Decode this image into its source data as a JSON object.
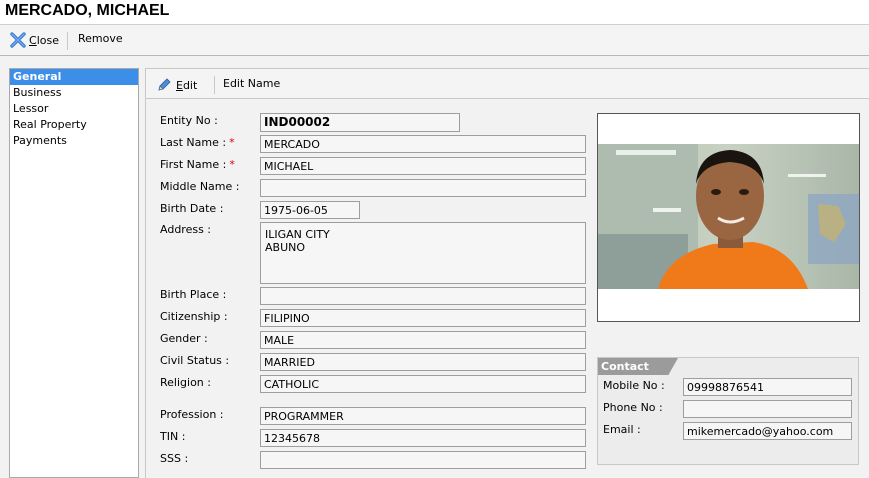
{
  "window": {
    "title": "MERCADO, MICHAEL"
  },
  "top_toolbar": {
    "close_label": "Close",
    "remove_label": "Remove"
  },
  "sidebar": {
    "items": [
      {
        "label": "General",
        "selected": true
      },
      {
        "label": "Business"
      },
      {
        "label": "Lessor"
      },
      {
        "label": "Real Property"
      },
      {
        "label": "Payments"
      }
    ]
  },
  "content_toolbar": {
    "edit_label": "Edit",
    "edit_name_label": "Edit Name"
  },
  "form": {
    "entity_no": {
      "label": "Entity No :",
      "value": "IND00002"
    },
    "last_name": {
      "label": "Last Name :",
      "required": "*",
      "value": "MERCADO"
    },
    "first_name": {
      "label": "First Name :",
      "required": "*",
      "value": "MICHAEL"
    },
    "middle_name": {
      "label": "Middle Name :",
      "value": ""
    },
    "birth_date": {
      "label": "Birth Date :",
      "value": "1975-06-05"
    },
    "address": {
      "label": "Address :",
      "value": "ILIGAN CITY\nABUNO"
    },
    "birth_place": {
      "label": "Birth Place :",
      "value": ""
    },
    "citizenship": {
      "label": "Citizenship :",
      "value": "FILIPINO"
    },
    "gender": {
      "label": "Gender :",
      "value": "MALE"
    },
    "civil_status": {
      "label": "Civil Status :",
      "value": "MARRIED"
    },
    "religion": {
      "label": "Religion :",
      "value": "CATHOLIC"
    },
    "profession": {
      "label": "Profession :",
      "value": "PROGRAMMER"
    },
    "tin": {
      "label": "TIN :",
      "value": "12345678"
    },
    "sss": {
      "label": "SSS :",
      "value": ""
    }
  },
  "contact": {
    "title": "Contact Info",
    "mobile": {
      "label": "Mobile No :",
      "value": "09998876541"
    },
    "phone": {
      "label": "Phone No :",
      "value": ""
    },
    "email": {
      "label": "Email :",
      "value": "mikemercado@yahoo.com"
    }
  },
  "icons": {
    "close": "close-x-icon",
    "edit": "pencil-icon",
    "photo": "person-photo"
  },
  "colors": {
    "selected_bg": "#3d8ee9",
    "required": "#e00000",
    "shirt": "#f07a1a",
    "contact_tab": "#9b9b9b"
  }
}
